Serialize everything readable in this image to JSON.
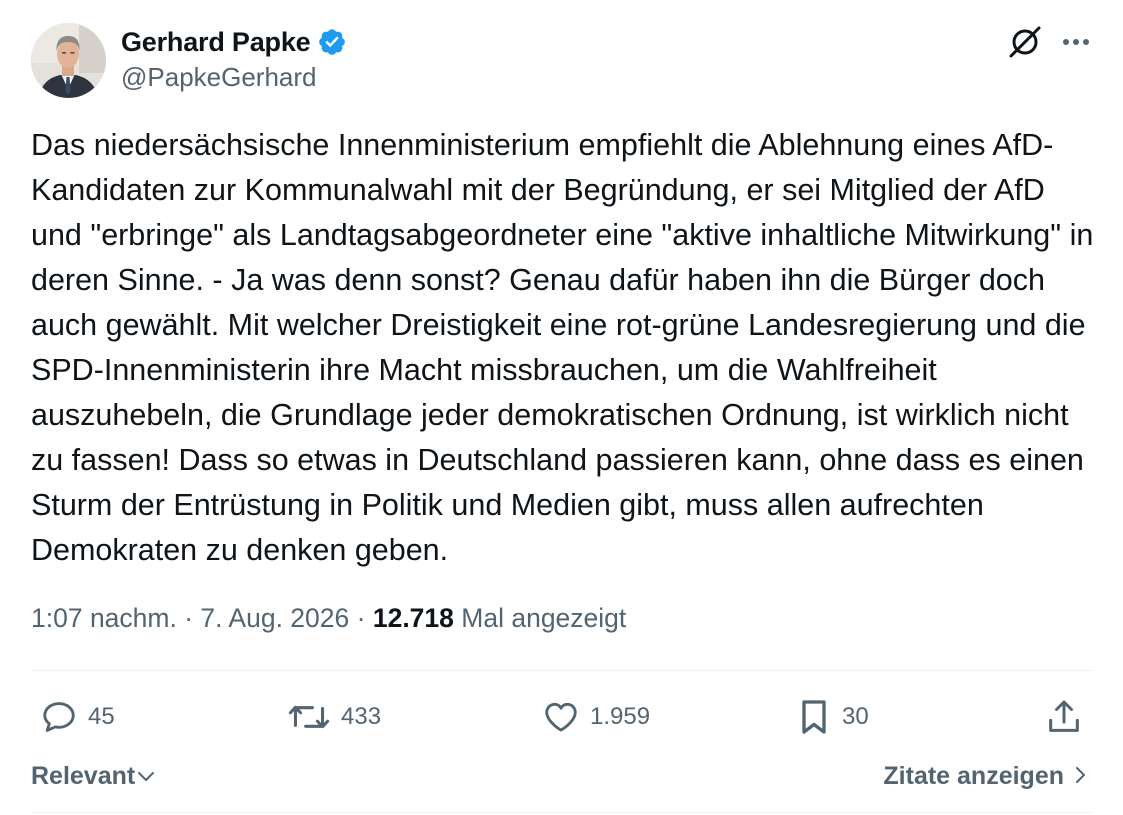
{
  "author": {
    "display_name": "Gerhard Papke",
    "handle": "@PapkeGerhard",
    "verified_color": "#1d9bf0"
  },
  "icons": {
    "verified": "verified-badge-icon",
    "grok": "grok-icon",
    "more": "more-horizontal-icon",
    "reply": "reply-icon",
    "retweet": "retweet-icon",
    "like": "heart-icon",
    "bookmark": "bookmark-icon",
    "share": "share-icon",
    "sort": "chevron-down-icon",
    "quotes": "chevron-right-icon"
  },
  "tweet": {
    "text": "Das niedersächsische Innenministerium empfiehlt die Ablehnung eines AfD-Kandidaten zur Kommunalwahl mit der Begründung, er sei Mitglied der AfD und \"erbringe\" als Landtagsabgeordneter eine \"aktive inhaltliche Mitwirkung\" in deren Sinne. - Ja was denn sonst? Genau dafür haben ihn die Bürger doch auch gewählt. Mit welcher Dreistigkeit eine rot-grüne Landesregierung und die SPD-Innenministerin ihre Macht missbrauchen, um die Wahlfreiheit auszuhebeln, die Grundlage jeder demokratischen Ordnung, ist wirklich nicht zu fassen! Dass so etwas in Deutschland passieren kann, ohne dass es einen Sturm der Entrüstung in Politik und Medien gibt, muss allen aufrechten Demokraten zu denken geben.",
    "time": "1:07 nachm.",
    "separator": "·",
    "date": "7. Aug. 2026",
    "views": "12.718",
    "views_label": "Mal angezeigt"
  },
  "actions": {
    "replies": "45",
    "retweets": "433",
    "likes": "1.959",
    "bookmarks": "30"
  },
  "footer": {
    "sort_label": "Relevant",
    "quotes_label": "Zitate anzeigen"
  },
  "colors": {
    "text": "#0f1419",
    "secondary": "#536471",
    "divider": "#eff3f4",
    "accent": "#1d9bf0"
  }
}
